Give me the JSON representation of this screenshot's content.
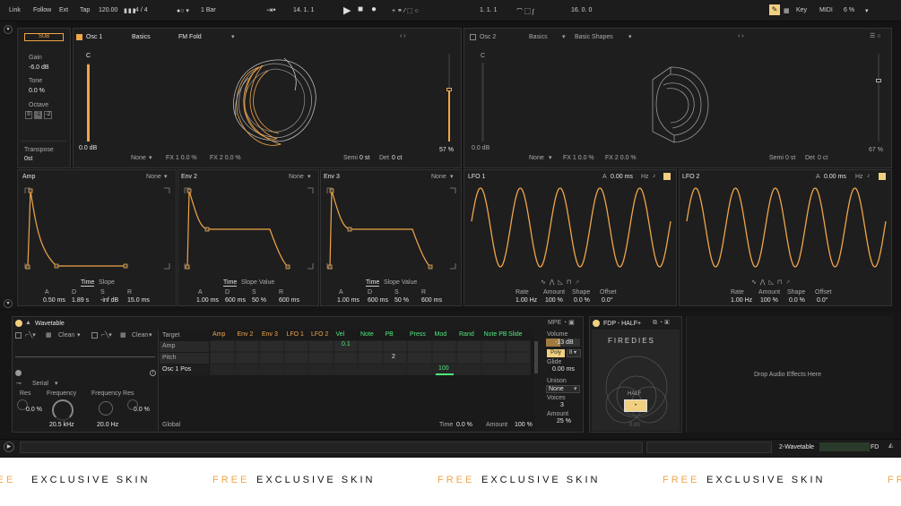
{
  "transport": {
    "link": "Link",
    "follow": "Follow",
    "ext": "Ext",
    "tap": "Tap",
    "tempo": "120.00",
    "sig": "4 / 4",
    "quant": "1 Bar",
    "pos1": "14.  1.  1",
    "pos2": "1.  1.  1",
    "pos3": "16.  0.  0",
    "key": "Key",
    "midi": "MIDI",
    "cpu": "6 %"
  },
  "sub": {
    "title": "SUB",
    "gain_label": "Gain",
    "gain": "-6.0 dB",
    "tone_label": "Tone",
    "tone": "0.0 %",
    "octave_label": "Octave",
    "octaves": [
      "0",
      "-1",
      "-2"
    ],
    "transpose_label": "Transpose",
    "transpose": "0st"
  },
  "osc1": {
    "title": "Osc 1",
    "category": "Basics",
    "wavetable": "FM Fold",
    "note": "C",
    "level": "0.0 dB",
    "fx1_mode": "None",
    "fx1": "FX 1  0.0 %",
    "fx2": "FX 2  0.0 %",
    "semi_label": "Semi",
    "semi": "0 st",
    "det_label": "Det",
    "det": "0 ct",
    "pos": "57 %"
  },
  "osc2": {
    "title": "Osc 2",
    "category": "Basics",
    "wavetable": "Basic Shapes",
    "note": "C",
    "level": "0.0 dB",
    "fx1_mode": "None",
    "fx1": "FX 1  0.0 %",
    "fx2": "FX 2  0.0 %",
    "semi_label": "Semi",
    "semi": "0 st",
    "det_label": "Det",
    "det": "0 ct",
    "pos": "67 %"
  },
  "envs": [
    {
      "title": "Amp",
      "mode": "None",
      "tab": "Time",
      "tab2": "Slope",
      "A": "0.50 ms",
      "D": "1.89 s",
      "S": "-inf dB",
      "R": "15.0 ms"
    },
    {
      "title": "Env 2",
      "mode": "None",
      "tab": "Time",
      "tab2": "Slope  Value",
      "A": "1.00 ms",
      "D": "600 ms",
      "S": "50 %",
      "R": "600 ms"
    },
    {
      "title": "Env 3",
      "mode": "None",
      "tab": "Time",
      "tab2": "Slope  Value",
      "A": "1.00 ms",
      "D": "600 ms",
      "S": "50 %",
      "R": "600 ms"
    }
  ],
  "env_param_labels": [
    "A",
    "D",
    "S",
    "R"
  ],
  "lfos": [
    {
      "title": "LFO 1",
      "a_label": "A",
      "a": "0.00 ms",
      "unit": "Hz",
      "rate": "1.00 Hz",
      "amount": "100 %",
      "shape": "0.0 %",
      "offset": "0.0°"
    },
    {
      "title": "LFO 2",
      "a_label": "A",
      "a": "0.00 ms",
      "unit": "Hz",
      "rate": "1.00 Hz",
      "amount": "100 %",
      "shape": "0.0 %",
      "offset": "0.0°"
    }
  ],
  "lfo_param_labels": [
    "Rate",
    "Amount",
    "Shape",
    "Offset"
  ],
  "device": {
    "title": "Wavetable",
    "filter1": "Clean",
    "filter2": "Clean",
    "routing": "Serial",
    "res_label": "Res",
    "res": "0.0 %",
    "freq_label": "Frequency",
    "freq": "20.5 kHz",
    "freqres_label": "Frequency Res",
    "freqres_freq": "20.0 Hz",
    "freqres_res": "0.0 %"
  },
  "matrix": {
    "target_label": "Target",
    "global_label": "Global",
    "sources": [
      "Amp",
      "Env 2",
      "Env 3",
      "LFO 1",
      "LFO 2",
      "Vel",
      "Note",
      "PB",
      "Press",
      "Mod",
      "Rand",
      "Note PB",
      "Slide"
    ],
    "rows": [
      "Amp",
      "Pitch",
      "Osc 1 Pos"
    ],
    "cells": {
      "amp_vel": "0.1",
      "pitch_pb": "2",
      "pos_mod": "100"
    },
    "time_label": "Time",
    "time": "0.0 %",
    "amount_label": "Amount",
    "amount": "100 %"
  },
  "voice": {
    "mpe": "MPE",
    "volume_label": "Volume",
    "volume": "-13 dB",
    "poly": "Poly",
    "poly_n": "8",
    "glide_label": "Glide",
    "glide": "0.00 ms",
    "unison_label": "Unison",
    "unison": "None",
    "voices_label": "Voices",
    "voices": "3",
    "amount_label": "Amount",
    "amount": "25 %"
  },
  "fx_device": {
    "title": "FDP - HALF+",
    "brand": "FIREDIES",
    "half": "HALF",
    "knob": "0.00"
  },
  "drop_text": "Drop Audio Effects Here",
  "footer": {
    "track": "2-Wavetable",
    "tag": "FD"
  },
  "banner": {
    "free": "FREE",
    "text": "EXCLUSIVE SKIN"
  },
  "colors": {
    "accent": "#f0a54a",
    "mod_green": "#4fe87a",
    "background": "#1e1e1e"
  }
}
